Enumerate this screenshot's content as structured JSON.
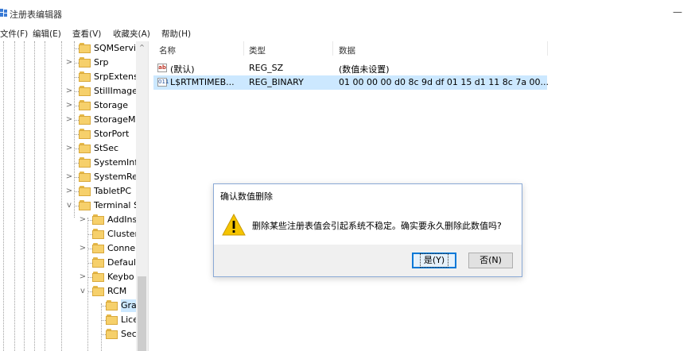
{
  "window": {
    "title": "注册表编辑器",
    "minimize": "—"
  },
  "menu": [
    "文件(F)",
    "编辑(E)",
    "查看(V)",
    "收藏夹(A)",
    "帮助(H)"
  ],
  "tree": [
    {
      "label": "SQMServi",
      "expander": ""
    },
    {
      "label": "Srp",
      "expander": ">"
    },
    {
      "label": "SrpExtens",
      "expander": ""
    },
    {
      "label": "StillImage",
      "expander": ">"
    },
    {
      "label": "Storage",
      "expander": ">"
    },
    {
      "label": "StorageM",
      "expander": ">"
    },
    {
      "label": "StorPort",
      "expander": ""
    },
    {
      "label": "StSec",
      "expander": ">"
    },
    {
      "label": "SystemInf",
      "expander": ""
    },
    {
      "label": "SystemRe",
      "expander": ">"
    },
    {
      "label": "TabletPC",
      "expander": ">"
    },
    {
      "label": "Terminal S",
      "expander": "v"
    },
    {
      "label": "AddIns",
      "expander": ">"
    },
    {
      "label": "Cluster",
      "expander": ""
    },
    {
      "label": "Conne",
      "expander": ">"
    },
    {
      "label": "Defaul",
      "expander": ""
    },
    {
      "label": "Keybo",
      "expander": ">"
    },
    {
      "label": "RCM",
      "expander": "v"
    },
    {
      "label": "Gra",
      "expander": ""
    },
    {
      "label": "Lice",
      "expander": ""
    },
    {
      "label": "Sec",
      "expander": ""
    }
  ],
  "scroll_up": "^",
  "columns": {
    "name": "名称",
    "type": "类型",
    "data": "数据"
  },
  "values": [
    {
      "icon": "ab",
      "name": "(默认)",
      "type": "REG_SZ",
      "data": "(数值未设置)"
    },
    {
      "icon": "011",
      "name": "L$RTMTIMEB...",
      "type": "REG_BINARY",
      "data": "01 00 00 00 d0 8c 9d df 01 15 d1 11 8c 7a 00..."
    }
  ],
  "dialog": {
    "title": "确认数值删除",
    "message": "删除某些注册表值会引起系统不稳定。确实要永久删除此数值吗?",
    "yes": "是(Y)",
    "no": "否(N)"
  },
  "colors": {
    "selection": "#cce8ff",
    "accent": "#0078d7",
    "warning": "#f5c400"
  }
}
